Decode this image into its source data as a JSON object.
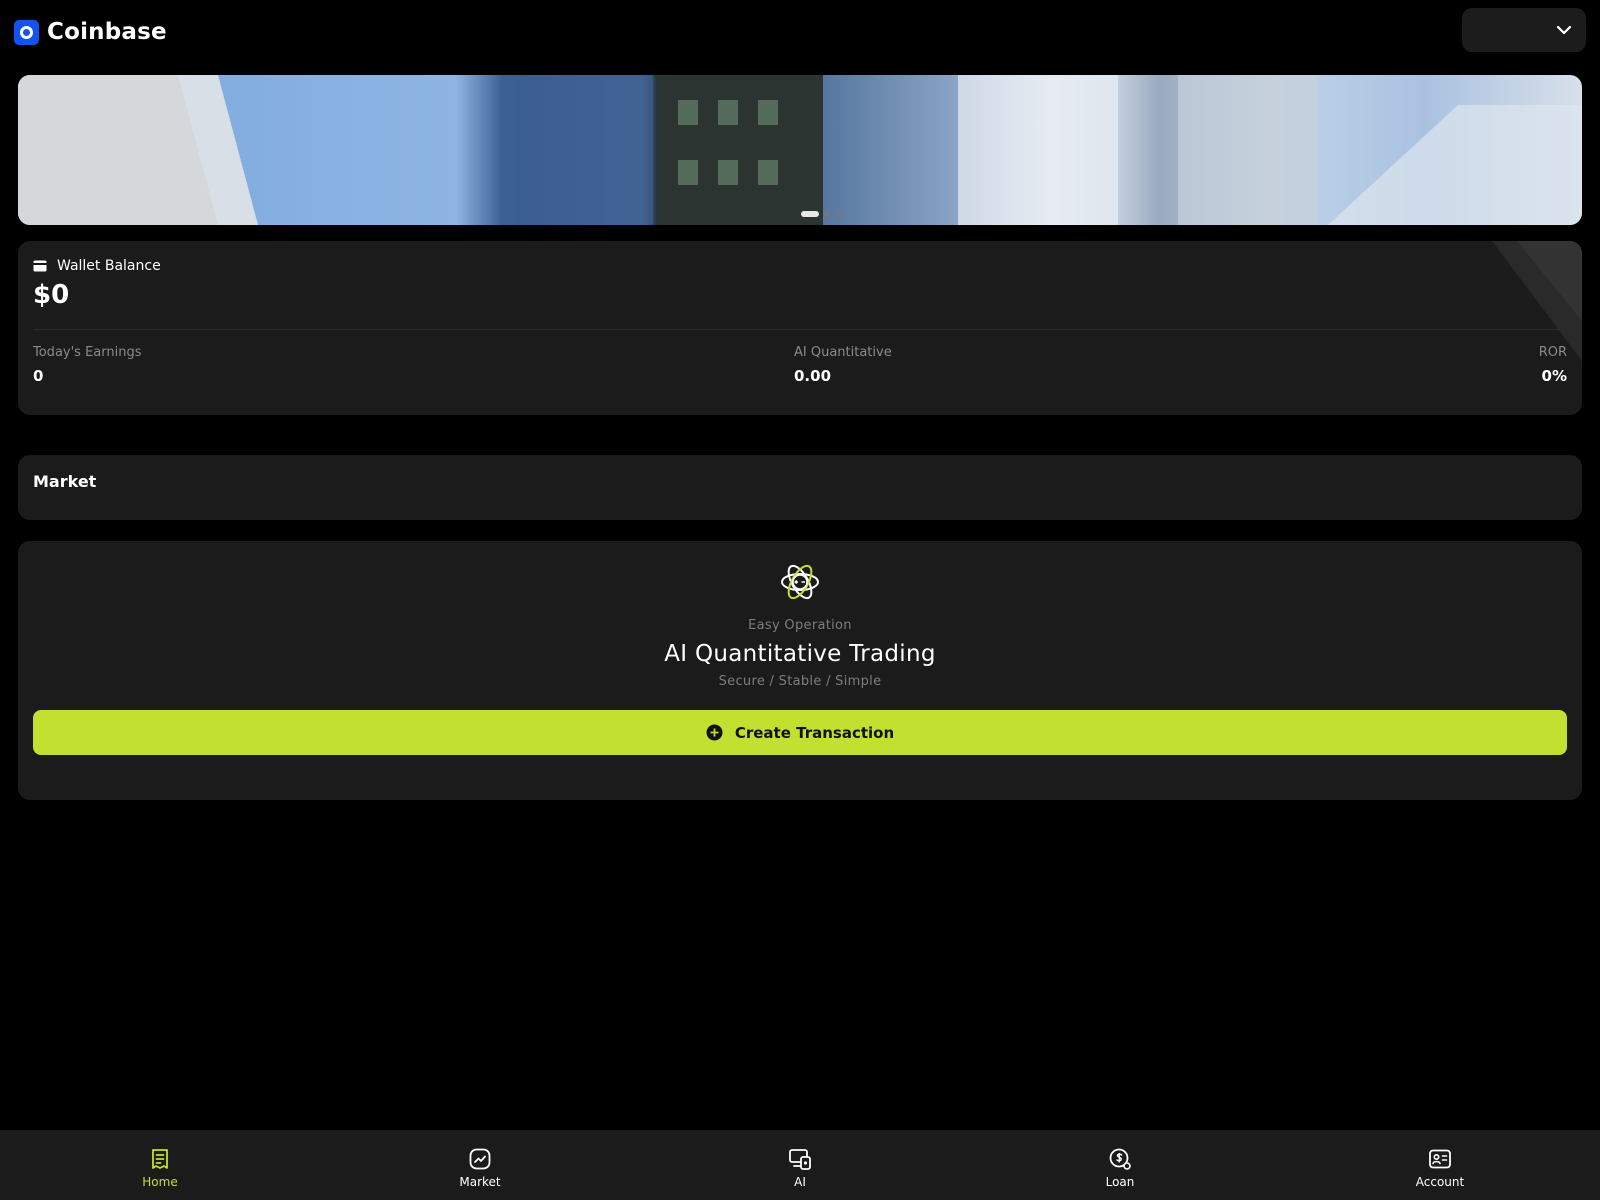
{
  "header": {
    "brand_name": "Coinbase",
    "language_select_value": ""
  },
  "banner": {
    "slide_count": 3,
    "active_slide": 1
  },
  "wallet": {
    "title": "Wallet Balance",
    "balance": "$0",
    "stats": [
      {
        "label": "Today's Earnings",
        "value": "0"
      },
      {
        "label": "AI Quantitative",
        "value": "0.00"
      },
      {
        "label": "ROR",
        "value": "0%"
      }
    ]
  },
  "market": {
    "title": "Market"
  },
  "ai_card": {
    "subtitle": "Easy Operation",
    "title": "AI Quantitative Trading",
    "tagline": "Secure / Stable / Simple",
    "button_label": "Create Transaction"
  },
  "tabs": [
    {
      "label": "Home",
      "icon": "receipt-icon",
      "active": true
    },
    {
      "label": "Market",
      "icon": "chart-icon",
      "active": false
    },
    {
      "label": "AI",
      "icon": "ai-device-icon",
      "active": false
    },
    {
      "label": "Loan",
      "icon": "coin-icon",
      "active": false
    },
    {
      "label": "Account",
      "icon": "id-card-icon",
      "active": false
    }
  ],
  "colors": {
    "accent": "#c2e02f",
    "background": "#000000",
    "card": "#1b1b1b",
    "brand_blue": "#1652f0"
  }
}
